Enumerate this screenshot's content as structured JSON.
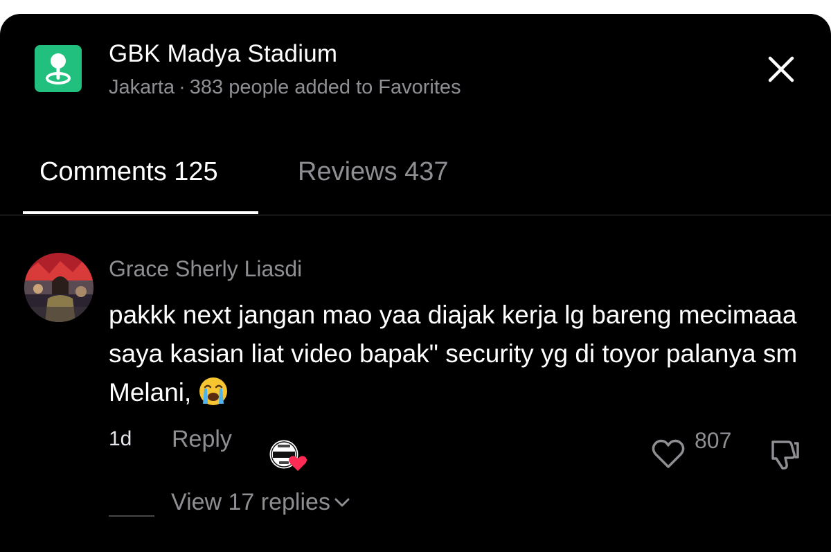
{
  "place": {
    "icon": "location-pin-icon",
    "icon_color": "#22c07e",
    "title": "GBK Madya Stadium",
    "city": "Jakarta",
    "separator": "·",
    "favorites_text": "383 people added to Favorites"
  },
  "header": {
    "close_icon": "close-icon"
  },
  "tabs": [
    {
      "label": "Comments 125",
      "active": true
    },
    {
      "label": "Reviews 437",
      "active": false
    }
  ],
  "comment": {
    "username": "Grace Sherly Liasdi",
    "text": "pakkk next jangan mao yaa diajak kerja lg bareng mecimaaa saya kasian liat video bapak\" security yg di toyor palanya sm Melani,",
    "emoji": "loudly-crying-face-emoji",
    "time": "1d",
    "reply_label": "Reply",
    "creator_liked_icon": "creator-liked-badge",
    "likes": "807",
    "view_replies_label": "View 17 replies"
  },
  "colors": {
    "background": "#000000",
    "primary_text": "#ffffff",
    "secondary_text": "#8e8e93",
    "heart_badge": "#fe2c55"
  }
}
